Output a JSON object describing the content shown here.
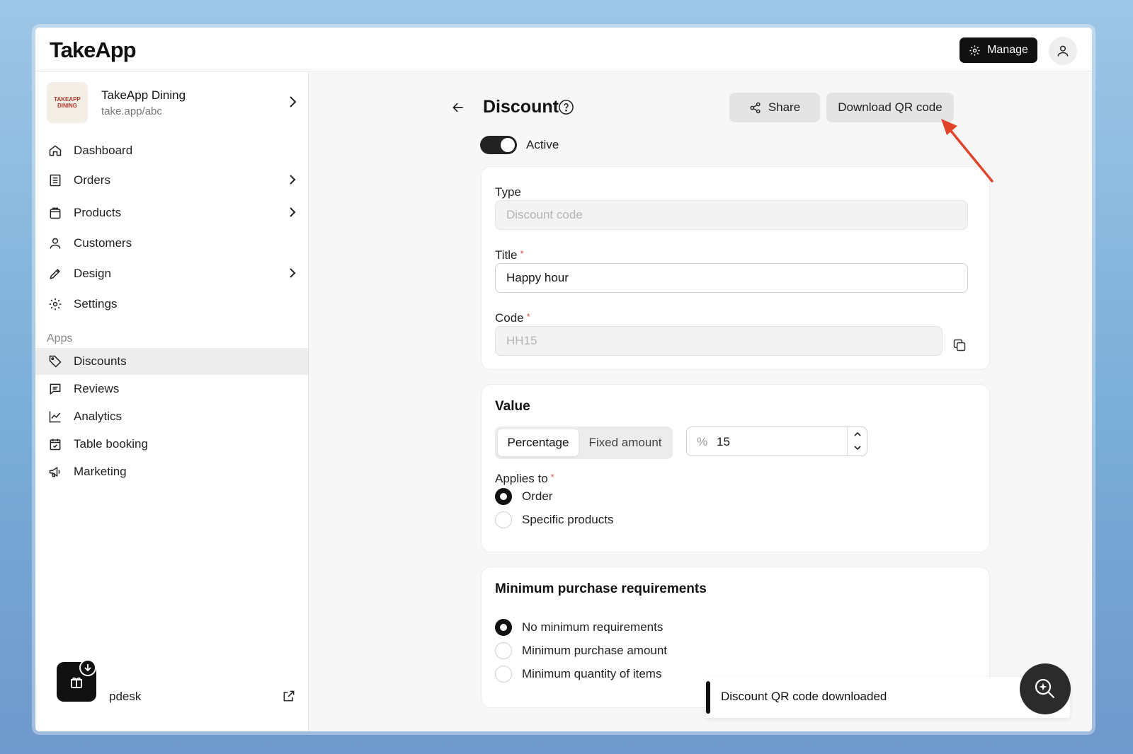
{
  "app": {
    "logo": "TakeApp"
  },
  "header": {
    "manage_label": "Manage"
  },
  "store": {
    "logo_text": "TAKEAPP DINING",
    "name": "TakeApp Dining",
    "url": "take.app/abc"
  },
  "sidebar": {
    "items": [
      {
        "label": "Dashboard"
      },
      {
        "label": "Orders"
      },
      {
        "label": "Products"
      },
      {
        "label": "Customers"
      },
      {
        "label": "Design"
      },
      {
        "label": "Settings"
      }
    ],
    "apps_label": "Apps",
    "apps": [
      {
        "label": "Discounts"
      },
      {
        "label": "Reviews"
      },
      {
        "label": "Analytics"
      },
      {
        "label": "Table booking"
      },
      {
        "label": "Marketing"
      }
    ],
    "helpdesk_label": "pdesk"
  },
  "page": {
    "title": "Discount",
    "share_label": "Share",
    "download_qr_label": "Download QR code",
    "active_label": "Active"
  },
  "form": {
    "type_label": "Type",
    "type_placeholder": "Discount code",
    "title_label": "Title",
    "title_value": "Happy hour",
    "code_label": "Code",
    "code_value": "HH15",
    "required_mark": "*"
  },
  "value": {
    "heading": "Value",
    "tab_percentage": "Percentage",
    "tab_fixed": "Fixed amount",
    "prefix": "%",
    "amount": "15",
    "applies_label": "Applies to",
    "option_order": "Order",
    "option_specific": "Specific products"
  },
  "minimum": {
    "heading": "Minimum purchase requirements",
    "option_none": "No minimum requirements",
    "option_amount": "Minimum purchase amount",
    "option_quantity": "Minimum quantity of items"
  },
  "toast": {
    "message": "Discount QR code downloaded"
  },
  "colors": {
    "accent": "#111111",
    "required": "#d9534f",
    "annotation_arrow": "#e0452b"
  }
}
